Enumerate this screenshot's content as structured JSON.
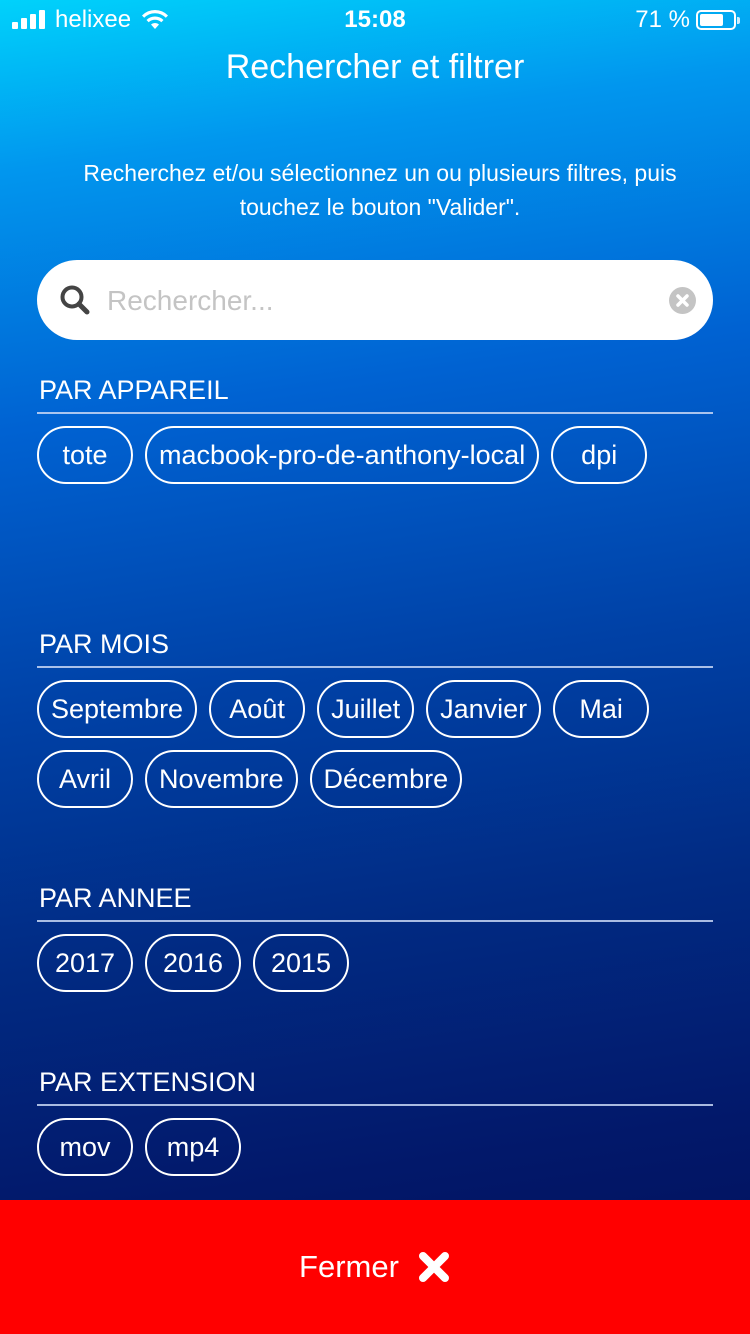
{
  "status_bar": {
    "carrier": "helixee",
    "time": "15:08",
    "battery_percent_text": "71 %",
    "battery_level": 0.71,
    "icons": [
      "signal-icon",
      "wifi-icon",
      "battery-icon"
    ]
  },
  "header": {
    "title": "Rechercher et filtrer"
  },
  "instructions": "Recherchez et/ou sélectionnez un ou plusieurs filtres, puis touchez le bouton \"Valider\".",
  "search": {
    "placeholder": "Rechercher...",
    "value": "",
    "icon": "search-icon",
    "clear_icon": "clear-icon"
  },
  "sections": [
    {
      "title": "PAR APPAREIL",
      "chips": [
        "tote",
        "macbook-pro-de-anthony-local",
        "dpi"
      ]
    },
    {
      "title": "PAR MOIS",
      "chips": [
        "Septembre",
        "Août",
        "Juillet",
        "Janvier",
        "Mai",
        "Avril",
        "Novembre",
        "Décembre"
      ]
    },
    {
      "title": "PAR ANNEE",
      "chips": [
        "2017",
        "2016",
        "2015"
      ]
    },
    {
      "title": "PAR EXTENSION",
      "chips": [
        "mov",
        "mp4"
      ]
    }
  ],
  "footer": {
    "close_label": "Fermer",
    "close_icon": "close-icon",
    "color": "#ff0000"
  }
}
